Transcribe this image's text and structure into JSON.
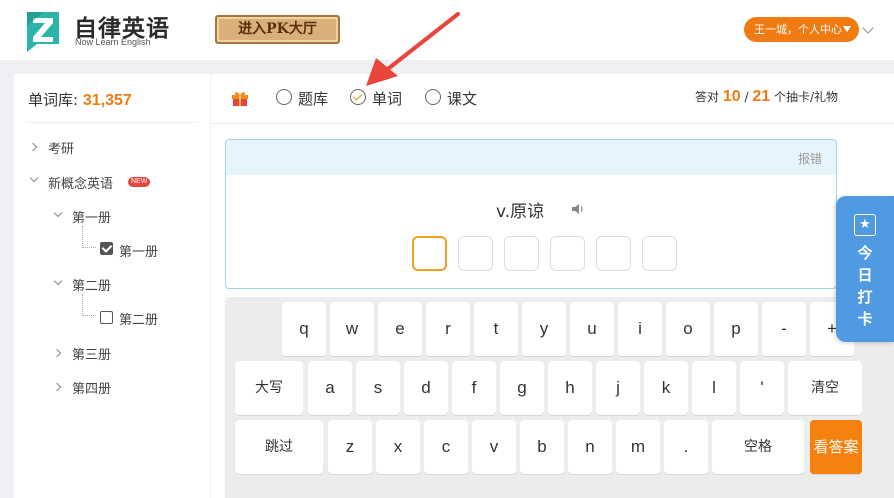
{
  "header": {
    "logo_title": "自律英语",
    "logo_subtitle": "Now Learn English",
    "pk_button": "进入PK大厅",
    "user_menu": "王一城，个人中心"
  },
  "sidebar": {
    "lib_label": "单词库:",
    "lib_count": "31,357",
    "items": [
      {
        "label": "考研"
      },
      {
        "label": "新概念英语",
        "badge": "NEW"
      },
      {
        "label": "第一册"
      },
      {
        "label": "第一册",
        "checked": true
      },
      {
        "label": "第二册"
      },
      {
        "label": "第二册",
        "checked": false
      },
      {
        "label": "第三册"
      },
      {
        "label": "第四册"
      }
    ]
  },
  "toolbar": {
    "modes": [
      {
        "label": "题库",
        "selected": false
      },
      {
        "label": "单词",
        "selected": true
      },
      {
        "label": "课文",
        "selected": false
      }
    ],
    "score_prefix": "答对",
    "correct": "10",
    "separator": "/",
    "total": "21",
    "score_suffix": "个抽卡/礼物"
  },
  "question": {
    "report": "报错",
    "prompt": "v.原谅",
    "letter_count": 6
  },
  "keyboard": {
    "row1": [
      "q",
      "w",
      "e",
      "r",
      "t",
      "y",
      "u",
      "i",
      "o",
      "p",
      "-",
      "+"
    ],
    "row2": [
      "大写",
      "a",
      "s",
      "d",
      "f",
      "g",
      "h",
      "j",
      "k",
      "l",
      "'",
      "清空"
    ],
    "row3": [
      "跳过",
      "z",
      "x",
      "c",
      "v",
      "b",
      "n",
      "m",
      ".",
      "空格",
      "看答案"
    ]
  },
  "checkin": {
    "label": "今日打卡"
  },
  "colors": {
    "accent_orange": "#f07b12",
    "checkin_blue": "#4f9ae0",
    "arrow_red": "#e8453c"
  }
}
